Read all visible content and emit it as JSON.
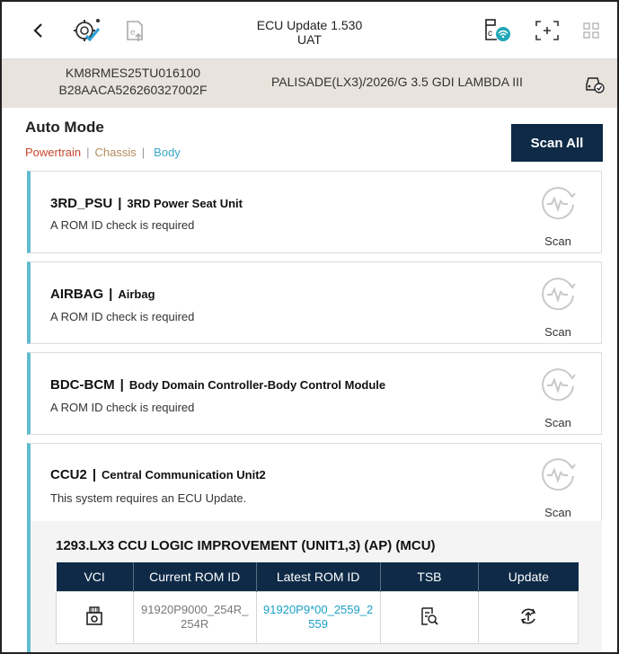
{
  "header": {
    "title_line1": "ECU Update 1.530",
    "title_line2": "UAT"
  },
  "vehicle": {
    "vin": "KM8RMES25TU016100",
    "id2": "B28AACA526260327002F",
    "model": "PALISADE(LX3)/2026/G 3.5 GDI LAMBDA III"
  },
  "mode": {
    "title": "Auto Mode",
    "filters": [
      "Powertrain",
      "Chassis",
      "Body"
    ],
    "scan_all_label": "Scan All"
  },
  "ecus": [
    {
      "code": "3RD_PSU",
      "desc": "3RD Power Seat Unit",
      "status": "A ROM ID check is required",
      "scan_label": "Scan"
    },
    {
      "code": "AIRBAG",
      "desc": "Airbag",
      "status": "A ROM ID check is required",
      "scan_label": "Scan"
    },
    {
      "code": "BDC-BCM",
      "desc": "Body Domain Controller-Body Control Module",
      "status": "A ROM ID check is required",
      "scan_label": "Scan"
    },
    {
      "code": "CCU2",
      "desc": "Central Communication Unit2",
      "status": "This system requires an ECU Update.",
      "scan_label": "Scan"
    }
  ],
  "update": {
    "title": "1293.LX3 CCU LOGIC IMPROVEMENT (UNIT1,3) (AP) (MCU)",
    "columns": [
      "VCI",
      "Current ROM ID",
      "Latest ROM ID",
      "TSB",
      "Update"
    ],
    "current_rom_line1": "91920P9000_254R_",
    "current_rom_line2": "254R",
    "latest_rom_line1": "91920P9*00_2559_2",
    "latest_rom_line2": "559"
  },
  "colors": {
    "navy": "#0e2a47",
    "accent": "#62bccf",
    "powertrain": "#c9482d",
    "chassis": "#b48a5e",
    "body": "#3aa7c8"
  }
}
